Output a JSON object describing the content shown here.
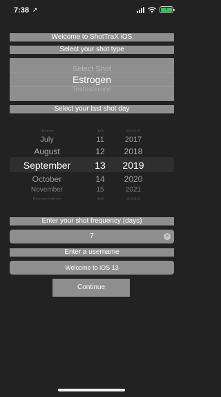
{
  "status_bar": {
    "time": "7:38",
    "location_glyph": "➚",
    "battery_label": "⚡"
  },
  "header": {
    "welcome": "Welcome to ShotTraX iOS",
    "shot_type_label": "Select your shot type"
  },
  "shot_type_picker": {
    "options": [
      "Select Shot",
      "Estrogen",
      "Testosterone"
    ],
    "selected": "Estrogen"
  },
  "date_section": {
    "label": "Select your last shot day"
  },
  "date_picker": {
    "months": [
      "June",
      "July",
      "August",
      "September",
      "October",
      "November",
      "December"
    ],
    "days": [
      "10",
      "11",
      "12",
      "13",
      "14",
      "15",
      "16"
    ],
    "years": [
      "2016",
      "2017",
      "2018",
      "2019",
      "2020",
      "2021",
      "2022"
    ],
    "selected": {
      "month": "September",
      "day": "13",
      "year": "2019"
    }
  },
  "frequency": {
    "label": "Enter your shot frequency (days)",
    "value": "7"
  },
  "username": {
    "label": "Enter a username",
    "value": "Welcome to iOS 13"
  },
  "continue_button": {
    "label": "Continue"
  },
  "colors": {
    "background": "#222222",
    "control": "#8e8e8e",
    "battery": "#34c759"
  }
}
